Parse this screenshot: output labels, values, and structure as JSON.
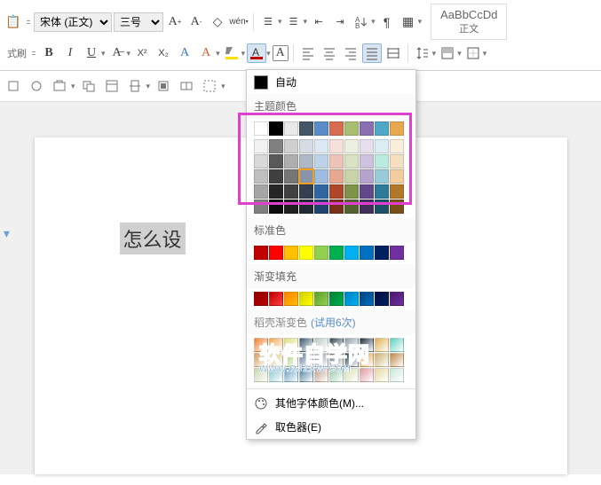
{
  "ribbon": {
    "split_label": "式刷",
    "font_name": "宋体 (正文)",
    "font_size": "三号",
    "tips": {
      "grow_font": "A+",
      "shrink_font": "A-",
      "clear": "◇",
      "phonetic": "wén",
      "bold": "B",
      "italic": "I",
      "underline": "U",
      "strike": "A",
      "super": "X²",
      "sub": "X₂",
      "char": "A",
      "textfx": "A",
      "highlight": "ab",
      "font_color": "A",
      "char_border": "A"
    },
    "style_preview": "AaBbCcDd",
    "style_name": "正文"
  },
  "document": {
    "selected_text": "怎么设"
  },
  "colorMenu": {
    "auto": "自动",
    "themeHeader": "主题颜色",
    "standardHeader": "标准色",
    "gradientHeader": "渐变填充",
    "docerHeader": "稻壳渐变色",
    "docerTrial": "(试用6次)",
    "moreColors": "其他字体颜色(M)...",
    "eyedropper": "取色器(E)",
    "themeRow1": [
      "#ffffff",
      "#000000",
      "#e8e8e8",
      "#445568",
      "#5a8dc8",
      "#d86c50",
      "#a8be70",
      "#8a70b0",
      "#50a8c8",
      "#e8a850"
    ],
    "themeShades": [
      [
        "#f2f2f2",
        "#808080",
        "#d0d0d0",
        "#d6dce4",
        "#dee8f4",
        "#f6e0da",
        "#ecf0e0",
        "#e6e0ee",
        "#dceef4",
        "#faeedc"
      ],
      [
        "#d9d9d9",
        "#595959",
        "#aeaeae",
        "#aeb8c6",
        "#bed2ea",
        "#eec4b8",
        "#dae2c4",
        "#cec2de",
        "#baeae0",
        "#f6dec0"
      ],
      [
        "#bfbfbf",
        "#404040",
        "#767676",
        "#8894a8",
        "#9ebce0",
        "#e6a890",
        "#c8d4a8",
        "#b6a4ce",
        "#98cada",
        "#f2ce9e"
      ],
      [
        "#a6a6a6",
        "#262626",
        "#404040",
        "#344052",
        "#3066a0",
        "#b04828",
        "#7e9248",
        "#614888",
        "#2c7a98",
        "#b07828"
      ],
      [
        "#808080",
        "#0d0d0d",
        "#202020",
        "#222a36",
        "#204470",
        "#78301a",
        "#546230",
        "#40305a",
        "#1c5266",
        "#78501a"
      ]
    ],
    "standard": [
      "#c00000",
      "#ff0000",
      "#ffc000",
      "#ffff00",
      "#92d050",
      "#00b050",
      "#00b0f0",
      "#0070c0",
      "#002060",
      "#7030a0"
    ],
    "gradientRow": [
      [
        "#8b0000",
        "#c00000"
      ],
      [
        "#c00000",
        "#ff4040"
      ],
      [
        "#ff8000",
        "#ffc000"
      ],
      [
        "#d0d000",
        "#ffff00"
      ],
      [
        "#5ca030",
        "#92d050"
      ],
      [
        "#008030",
        "#00b050"
      ],
      [
        "#0080c0",
        "#00b0f0"
      ],
      [
        "#004080",
        "#0070c0"
      ],
      [
        "#001040",
        "#002060"
      ],
      [
        "#4a1870",
        "#7030a0"
      ]
    ],
    "docerGrid": [
      [
        "#f08030",
        "#f0a850",
        "#dde080",
        "#3a5a70",
        "#c0c8c8",
        "#304850",
        "#90a0a8",
        "#203040",
        "#e0b050",
        "#60d0c0"
      ],
      [
        "#d8a060",
        "#d8c080",
        "#a8c878",
        "#6888a0",
        "#8090a0",
        "#607080",
        "#304858",
        "#e09838",
        "#c8b070",
        "#c08848"
      ],
      [
        "#c8d8b0",
        "#88c8d0",
        "#68a0c0",
        "#4880a0",
        "#c0a088",
        "#98c8a8",
        "#d8e0b0",
        "#e098a0",
        "#e8d8a0",
        "#c8e8d8"
      ]
    ]
  },
  "watermark": {
    "main": "软件自学网",
    "sub": "WWW.RJZXW.COM"
  }
}
